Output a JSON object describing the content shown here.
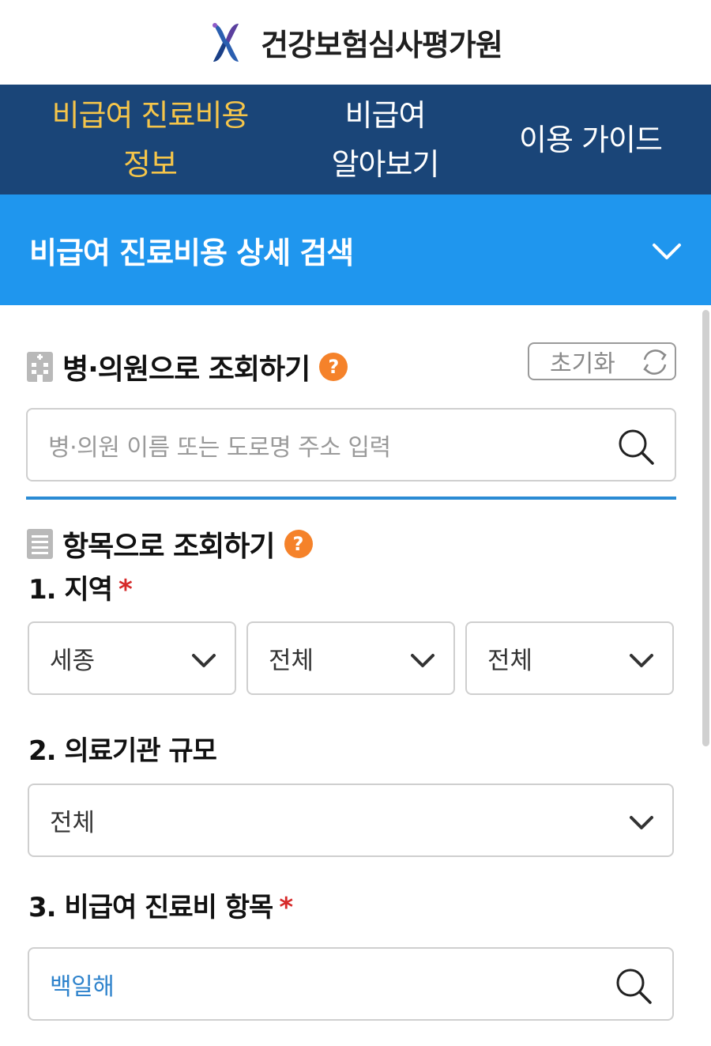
{
  "header": {
    "title": "건강보험심사평가원",
    "logo_icon": "hira-logo-icon"
  },
  "nav": {
    "items": [
      {
        "lines": [
          "비급여 진료비용",
          "정보"
        ],
        "active": true
      },
      {
        "lines": [
          "비급여",
          "알아보기"
        ],
        "active": false
      },
      {
        "lines": [
          "이용 가이드"
        ],
        "active": false
      }
    ]
  },
  "detail_search": {
    "title": "비급여 진료비용 상세 검색",
    "toggle_icon": "chevron-down-icon"
  },
  "hospital_search": {
    "title": "병·의원으로 조회하기",
    "help": "?",
    "reset_label": "초기화",
    "placeholder": "병·의원 이름 또는 도로명 주소 입력"
  },
  "item_search": {
    "title": "항목으로 조회하기",
    "help": "?",
    "region": {
      "label": "1. 지역",
      "required": "*",
      "selects": [
        "세종",
        "전체",
        "전체"
      ]
    },
    "scale": {
      "label": "2. 의료기관 규모",
      "value": "전체"
    },
    "item": {
      "label": "3. 비급여 진료비 항목",
      "required": "*",
      "value": "백일해"
    }
  },
  "colors": {
    "nav_bg": "#1a4578",
    "nav_active": "#f5c54a",
    "accent": "#1f96ee",
    "help": "#f5822a",
    "required": "#d62a2a"
  }
}
